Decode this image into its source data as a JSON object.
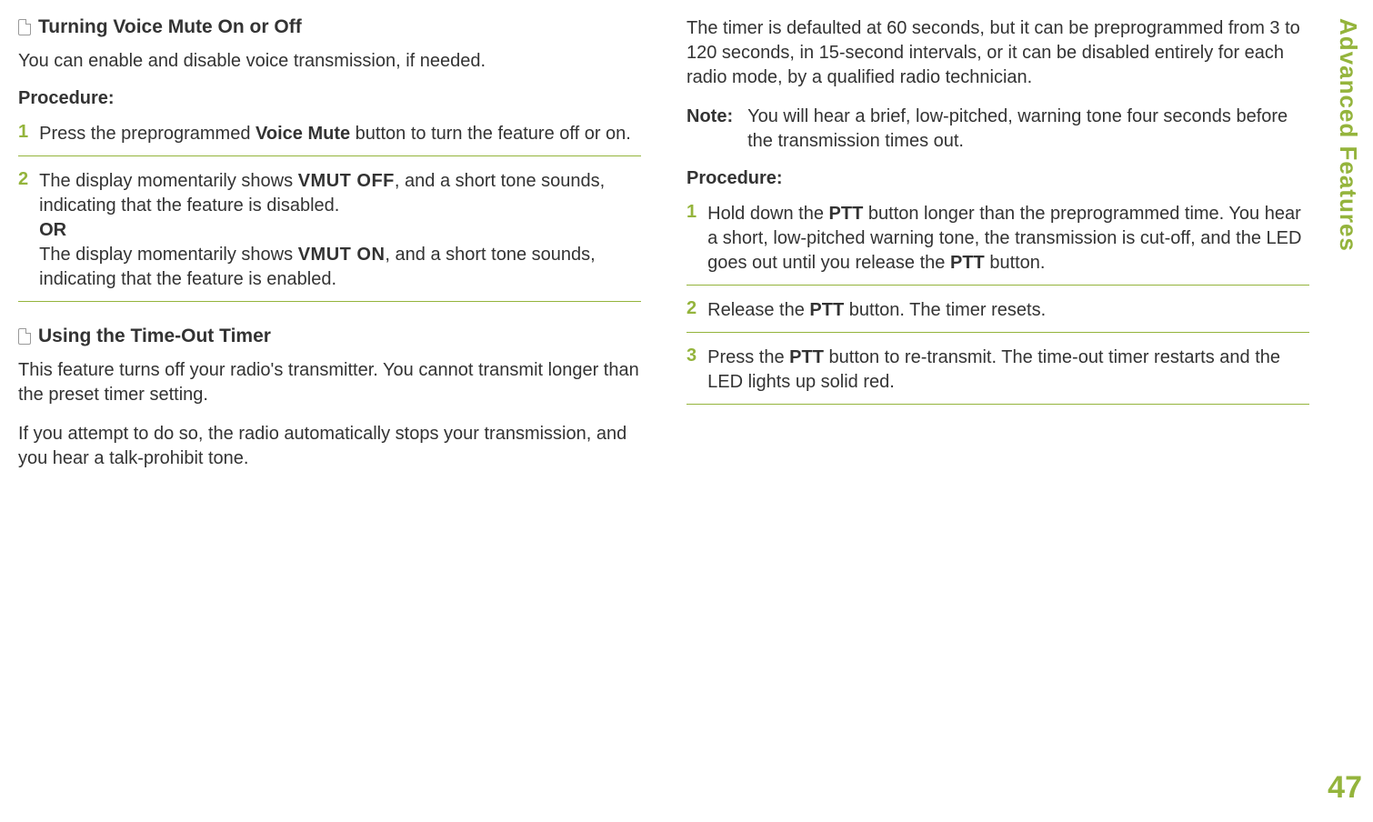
{
  "sidebar": {
    "tab_label": "Advanced Features",
    "page_number": "47"
  },
  "left": {
    "heading1": "Turning Voice Mute On or Off",
    "intro1": "You can enable and disable voice transmission, if needed.",
    "procedure_label": "Procedure:",
    "step1_pre": "Press the preprogrammed ",
    "step1_bold": "Voice Mute",
    "step1_post": " button to turn the feature off or on.",
    "step2_l1a": "The display momentarily shows ",
    "step2_vmut_off": "VMUT OFF",
    "step2_l1b": ", and a short tone sounds, indicating that the feature is disabled.",
    "step2_or": "OR",
    "step2_l2a": "The display momentarily shows ",
    "step2_vmut_on": "VMUT ON",
    "step2_l2b": ", and a short tone sounds, indicating that the feature is enabled.",
    "heading2": "Using the Time-Out Timer",
    "para2a": "This feature turns off your radio's transmitter. You cannot transmit longer than the preset timer setting.",
    "para2b": "If you attempt to do so, the radio automatically stops your transmission, and you hear a talk-prohibit tone."
  },
  "right": {
    "para1": "The timer is defaulted at 60 seconds, but it can be preprogrammed from 3 to 120 seconds, in 15-second intervals, or it can be disabled entirely for each radio mode, by a qualified radio technician.",
    "note_label": "Note:",
    "note_body": "You will hear a brief, low-pitched, warning tone four seconds before the transmission times out.",
    "procedure_label": "Procedure:",
    "step1_a": "Hold down the ",
    "ptt": "PTT",
    "step1_b": " button longer than the preprogrammed time. You hear a short, low-pitched warning tone, the transmission is cut-off, and the LED goes out until you release the ",
    "step1_c": " button.",
    "step2_a": "Release the ",
    "step2_b": " button. The timer resets.",
    "step3_a": "Press the ",
    "step3_b": " button to re-transmit. The time-out timer restarts and the LED lights up solid red."
  },
  "numbers": {
    "n1": "1",
    "n2": "2",
    "n3": "3"
  }
}
